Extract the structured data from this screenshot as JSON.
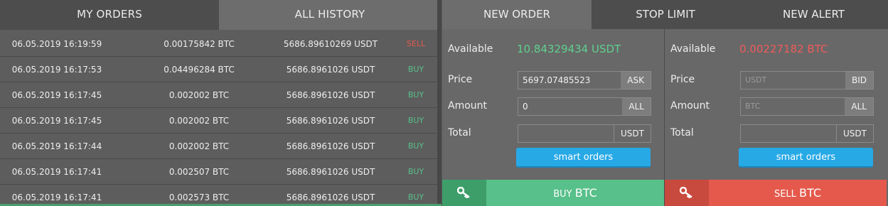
{
  "left_tabs": {
    "my_orders": "MY ORDERS",
    "all_history": "ALL HISTORY"
  },
  "orders": [
    {
      "date": "06.05.2019 16:19:59",
      "amount": "0.00175842 BTC",
      "price": "5686.89610269 USDT",
      "side": "SELL"
    },
    {
      "date": "06.05.2019 16:17:53",
      "amount": "0.04496284 BTC",
      "price": "5686.8961026 USDT",
      "side": "BUY"
    },
    {
      "date": "06.05.2019 16:17:45",
      "amount": "0.002002 BTC",
      "price": "5686.8961026 USDT",
      "side": "BUY"
    },
    {
      "date": "06.05.2019 16:17:45",
      "amount": "0.002002 BTC",
      "price": "5686.8961026 USDT",
      "side": "BUY"
    },
    {
      "date": "06.05.2019 16:17:44",
      "amount": "0.002002 BTC",
      "price": "5686.8961026 USDT",
      "side": "BUY"
    },
    {
      "date": "06.05.2019 16:17:41",
      "amount": "0.002507 BTC",
      "price": "5686.8961026 USDT",
      "side": "BUY"
    },
    {
      "date": "06.05.2019 16:17:41",
      "amount": "0.002573 BTC",
      "price": "5686.8961026 USDT",
      "side": "BUY"
    }
  ],
  "right_tabs": {
    "new_order": "NEW ORDER",
    "stop_limit": "STOP LIMIT",
    "new_alert": "NEW ALERT"
  },
  "buy_form": {
    "available_label": "Available",
    "available_value": "10.84329434 USDT",
    "price_label": "Price",
    "price_value": "5697.07485523",
    "price_suffix": "ASK",
    "amount_label": "Amount",
    "amount_value": "0",
    "amount_suffix": "ALL",
    "total_label": "Total",
    "total_value": "",
    "total_suffix": "USDT",
    "smart_label": "smart orders",
    "action_prefix": "BUY",
    "action_symbol": "BTC"
  },
  "sell_form": {
    "available_label": "Available",
    "available_value": "0.00227182 BTC",
    "price_label": "Price",
    "price_placeholder": "USDT",
    "price_suffix": "BID",
    "amount_label": "Amount",
    "amount_placeholder": "BTC",
    "amount_suffix": "ALL",
    "total_label": "Total",
    "total_value": "",
    "total_suffix": "USDT",
    "smart_label": "smart orders",
    "action_prefix": "SELL",
    "action_symbol": "BTC"
  },
  "colors": {
    "buy_green": "#58c08a",
    "sell_red": "#e4594c",
    "available_green": "#5fd08f",
    "available_red": "#ef5b5b",
    "smart_blue": "#27a9e6"
  },
  "icons": {
    "key": "key-icon"
  }
}
